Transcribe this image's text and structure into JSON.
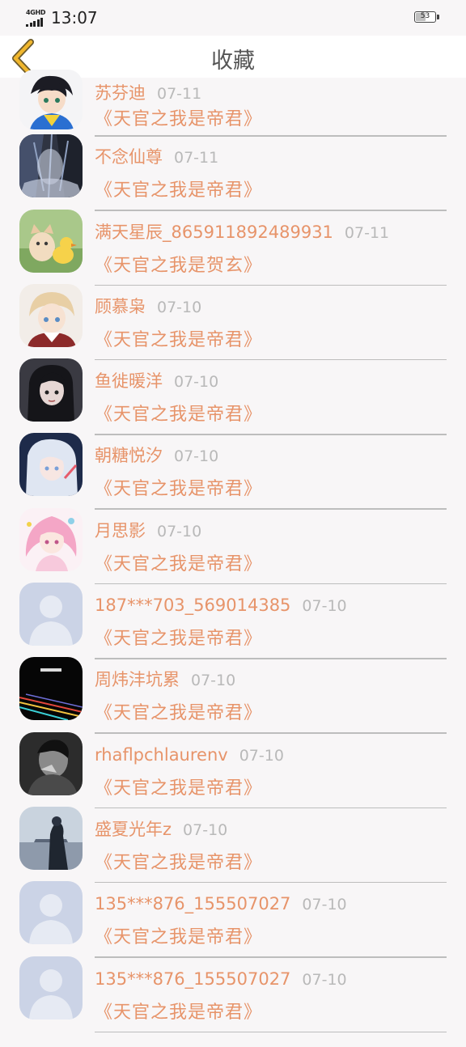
{
  "status_bar": {
    "network": "4GHD",
    "time": "13:07",
    "battery": "53",
    "battery_level": 0.53
  },
  "header": {
    "back_icon": "chevron-left-icon",
    "title": "收藏",
    "accent_color": "#f0b62d"
  },
  "colors": {
    "name": "#e7946a",
    "date": "#b9b9b9",
    "background": "#f8f6f7"
  },
  "favorites": [
    {
      "name": "苏芬迪",
      "date": "07-11",
      "book": "《天官之我是帝君》",
      "avatar": "anime-boy"
    },
    {
      "name": "不念仙尊",
      "date": "07-11",
      "book": "《天官之我是帝君》",
      "avatar": "dark-forest"
    },
    {
      "name": "满天星辰_865911892489931",
      "date": "07-11",
      "book": "《天官之我是贺玄》",
      "avatar": "kitten-duckling"
    },
    {
      "name": "顾慕枭",
      "date": "07-10",
      "book": "《天官之我是帝君》",
      "avatar": "anime-blonde"
    },
    {
      "name": "鱼徙暖洋",
      "date": "07-10",
      "book": "《天官之我是帝君》",
      "avatar": "anime-dark-hair"
    },
    {
      "name": "朝糖悦汐",
      "date": "07-10",
      "book": "《天官之我是帝君》",
      "avatar": "anime-silver-hair"
    },
    {
      "name": "月思影",
      "date": "07-10",
      "book": "《天官之我是帝君》",
      "avatar": "anime-pink-hair"
    },
    {
      "name": "187***703_569014385",
      "date": "07-10",
      "book": "《天官之我是帝君》",
      "avatar": "default-user"
    },
    {
      "name": "周炜沣坑累",
      "date": "07-10",
      "book": "《天官之我是帝君》",
      "avatar": "black-stripes"
    },
    {
      "name": "rhaflpchlaurenv",
      "date": "07-10",
      "book": "《天官之我是帝君》",
      "avatar": "grayscale-portrait"
    },
    {
      "name": "盛夏光年z",
      "date": "07-10",
      "book": "《天官之我是帝君》",
      "avatar": "misty-figure"
    },
    {
      "name": "135***876_155507027",
      "date": "07-10",
      "book": "《天官之我是帝君》",
      "avatar": "default-user"
    },
    {
      "name": "135***876_155507027",
      "date": "07-10",
      "book": "《天官之我是帝君》",
      "avatar": "default-user"
    }
  ]
}
